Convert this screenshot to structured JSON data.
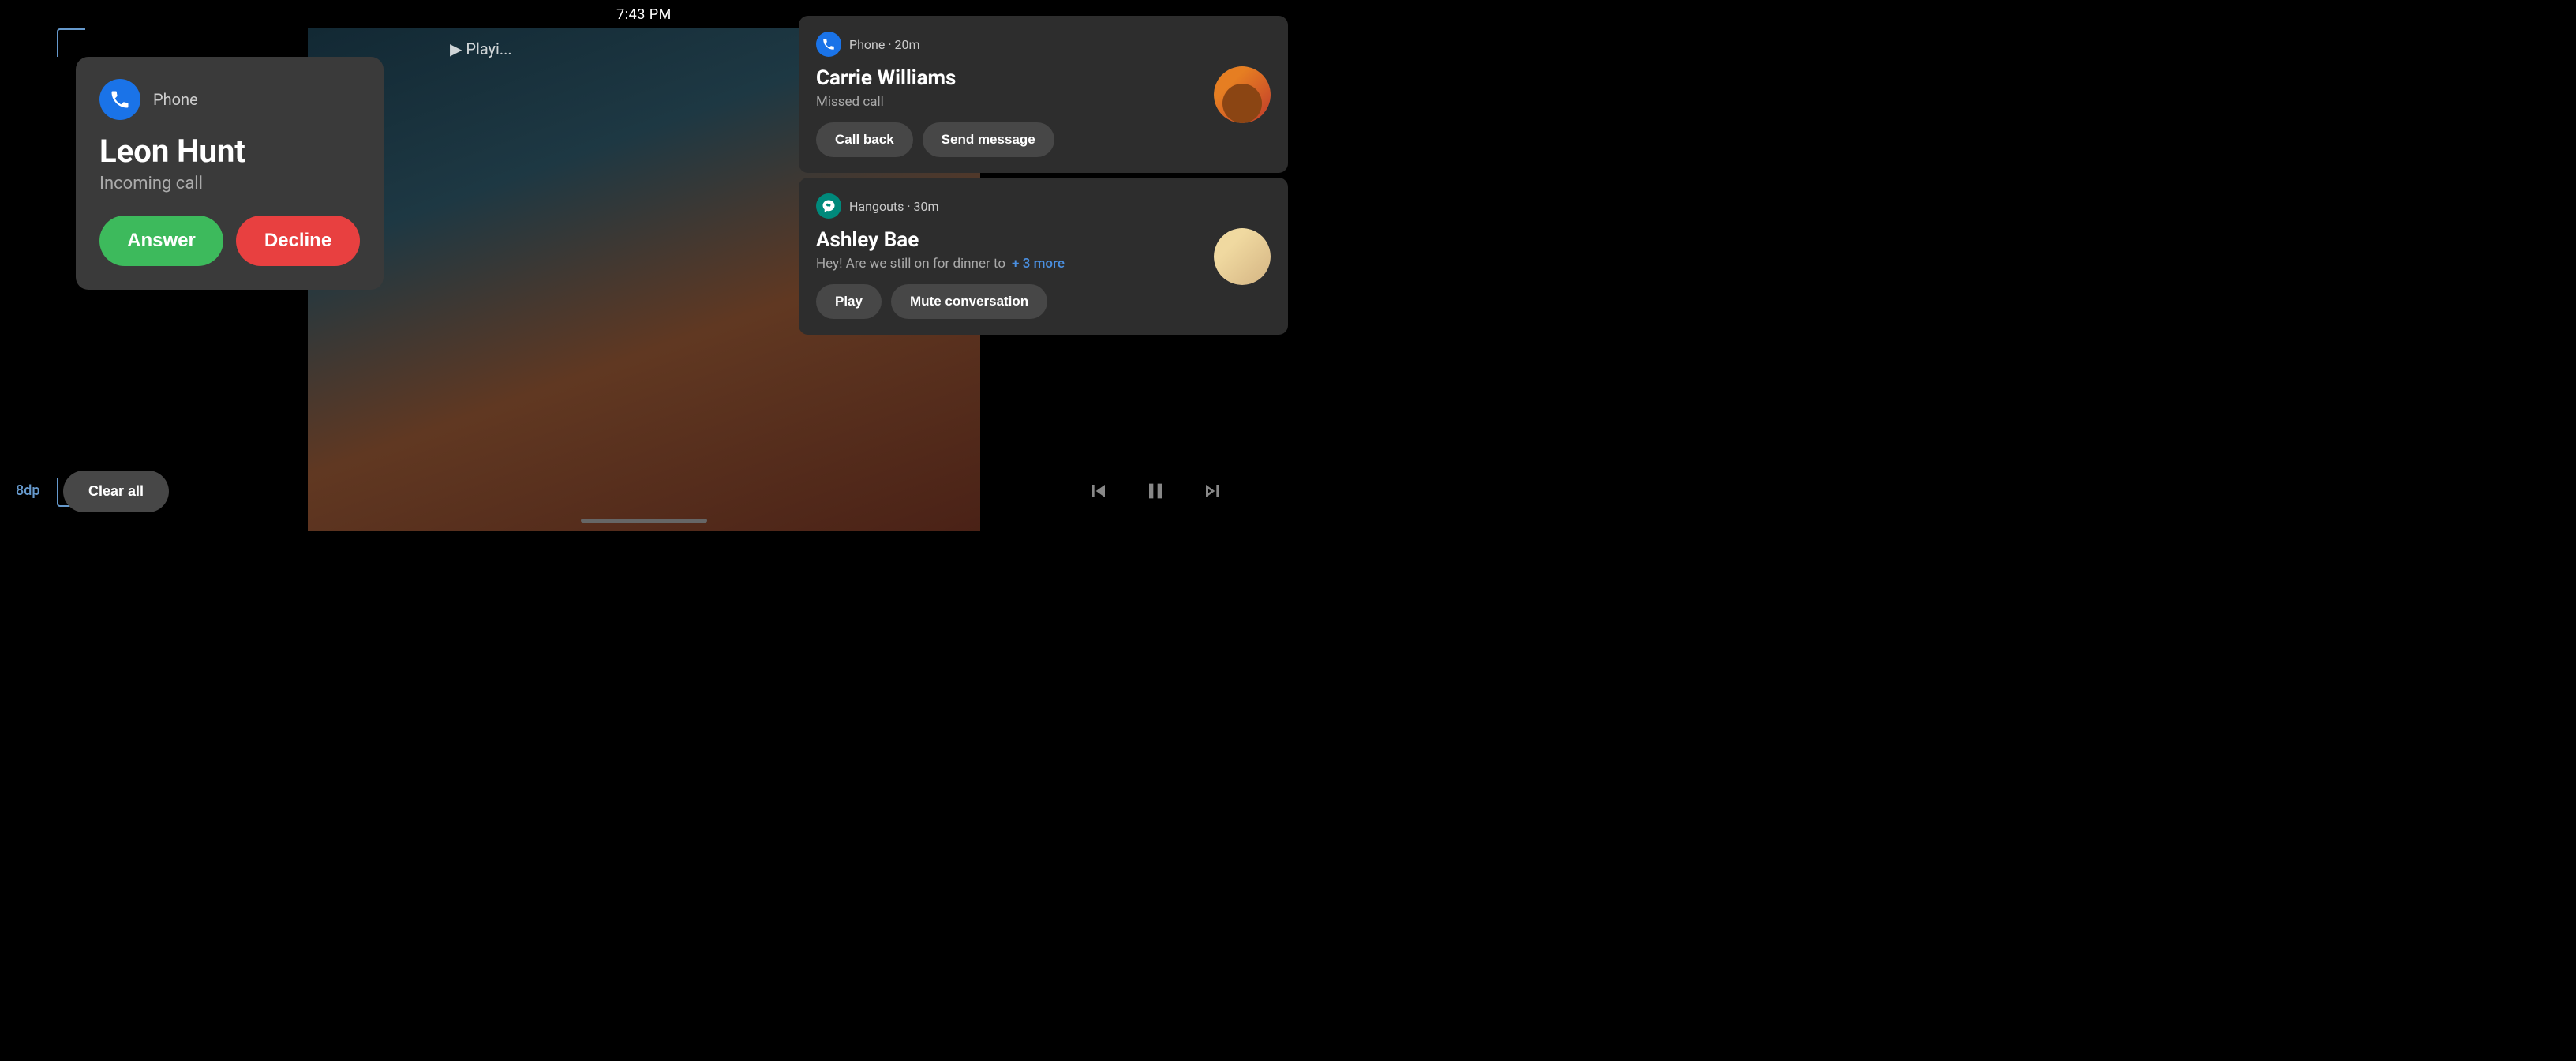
{
  "statusBar": {
    "time": "7:43 PM"
  },
  "label8dp": "8dp",
  "incomingCall": {
    "appName": "Phone",
    "callerName": "Leon Hunt",
    "callStatus": "Incoming call",
    "answerLabel": "Answer",
    "declineLabel": "Decline"
  },
  "nowPlaying": "Playing",
  "notifications": [
    {
      "id": "notif-1",
      "appName": "Phone · 20m",
      "contactName": "Carrie Williams",
      "subtitle": "Missed call",
      "buttons": [
        "Call back",
        "Send message"
      ],
      "hasAvatar": true,
      "avatarType": "1"
    },
    {
      "id": "notif-2",
      "appName": "Hangouts · 30m",
      "contactName": "Ashley Bae",
      "subtitle": "Hey! Are we still on for dinner to",
      "moreText": "+ 3 more",
      "buttons": [
        "Play",
        "Mute conversation"
      ],
      "hasAvatar": true,
      "avatarType": "2"
    }
  ],
  "bottomBar": {
    "clearAll": "Clear all"
  },
  "mediaControls": {
    "prevIcon": "skip-previous-icon",
    "playPauseIcon": "pause-icon",
    "nextIcon": "skip-next-icon"
  }
}
